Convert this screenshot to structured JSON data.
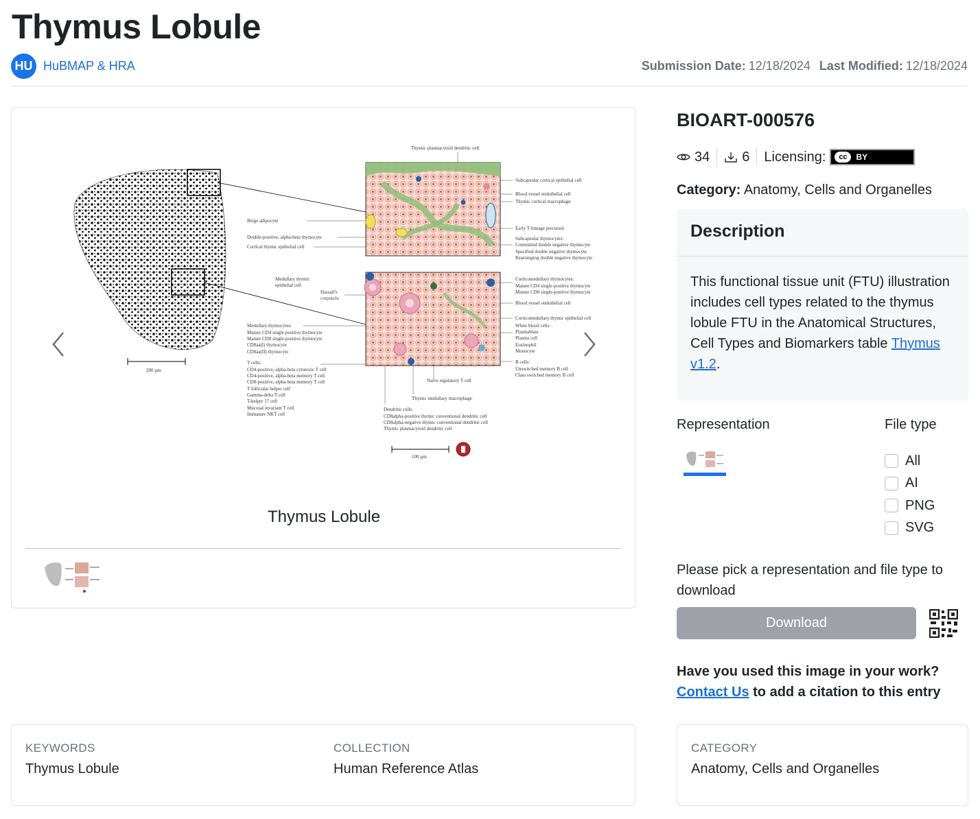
{
  "header": {
    "title": "Thymus Lobule",
    "avatar_initials": "HU",
    "author": "HuBMAP & HRA",
    "submission_label": "Submission Date:",
    "submission_value": "12/18/2024",
    "modified_label": "Last Modified:",
    "modified_value": "12/18/2024"
  },
  "gallery": {
    "caption": "Thymus Lobule",
    "figure_labels": {
      "top": "Thymic plasmacytoid dendritic cell",
      "r1": "Subcapsular cortical epithelial cell",
      "r2": "Blood vessel endothelial cell",
      "r3": "Thymic cortical macrophage",
      "r4": "Early T lineage precursor",
      "r5": "Subcapsular thymocytes:",
      "r6": "Committed double negative thymocyte",
      "r7": "Specified double negative thymocyte",
      "r8": "Rearranging double negative thymocyte",
      "l1": "Beige adipocyte",
      "l2": "Double-positive, alpha-beta thymocyte",
      "l3": "Cortical thymic epithelial cell",
      "l4": "Medullary thymic",
      "l4b": "epithelial cell",
      "l5": "Hassall's",
      "l5b": "corpuscle",
      "l6": "Medullary thymocytes:",
      "l7": "Mature CD4 single-positive thymocyte",
      "l8": "Mature CD8 single-positive thymocyte",
      "l9": "CD8aa(I) thymocyte",
      "l10": "CD8aa(II) thymocyte",
      "l11": "T cells:",
      "l12": "CD4-positive, alpha-beta cytotoxic T cell",
      "l13": "CD4-positive, alpha-beta memory T cell",
      "l14": "CD8-positive, alpha-beta memory T cell",
      "l15": "T follicular helper cell",
      "l16": "Gamma-delta T cell",
      "l17": "T-helper 17 cell",
      "l18": "Mucosal invariant T cell",
      "l19": "Immature NKT cell",
      "m1": "Corticomedullary thymocytes:",
      "m2": "Mature CD4 single-positive thymocyte",
      "m3": "Mature CD8 single-positive thymocyte",
      "m4": "Blood vessel endothelial cell",
      "m5": "Corticomedullary thymic epithelial cell",
      "m6": "White blood cells:",
      "m7": "Plasmablast",
      "m8": "Plasma cell",
      "m9": "Eosinophil",
      "m10": "Monocyte",
      "m11": "B cells:",
      "m12": "Unswitched memory B cell",
      "m13": "Class switched memory B cell",
      "b1": "Naive regulatory T cell",
      "b2": "Thymic medullary macrophage",
      "b3": "Dendritic cells:",
      "b4": "CD8alpha-positive thymic conventional dendritic cell",
      "b5": "CD8alpha-negative thymic conventional dendritic cell",
      "b6": "Thymic plasmacytoid dendritic cell",
      "scale1": "200 µm",
      "scale2": "100 µm"
    }
  },
  "details": {
    "id": "BIOART-000576",
    "views": "34",
    "downloads": "6",
    "licensing_label": "Licensing:",
    "license_cc": "cc",
    "license_by": "BY",
    "category_label": "Category:",
    "category_value": "Anatomy, Cells and Organelles",
    "description_title": "Description",
    "description_text": "This functional tissue unit (FTU) illustration includes cell types related to the thymus lobule FTU in the Anatomical Structures, Cell Types and Biomarkers table ",
    "description_link": "Thymus v1.2",
    "description_end": ".",
    "representation_label": "Representation",
    "filetype_label": "File type",
    "filetypes": [
      "All",
      "AI",
      "PNG",
      "SVG"
    ],
    "pick_message": "Please pick a representation and file type to download",
    "download_label": "Download",
    "cite_question": "Have you used this image in your work?",
    "cite_link": "Contact Us",
    "cite_rest": " to add a citation to this entry"
  },
  "meta": {
    "keywords_title": "KEYWORDS",
    "keywords_value": "Thymus Lobule",
    "collection_title": "COLLECTION",
    "collection_value": "Human Reference Atlas",
    "category_title": "CATEGORY",
    "category_value": "Anatomy, Cells and Organelles"
  },
  "colors": {
    "accent": "#1a73e8",
    "link": "#1a6fd6",
    "button_disabled": "#9ea2a8"
  },
  "icons": [
    "eye-icon",
    "download-icon",
    "chevron-left-icon",
    "chevron-right-icon",
    "qr-code-icon",
    "cc-by-license-icon"
  ]
}
